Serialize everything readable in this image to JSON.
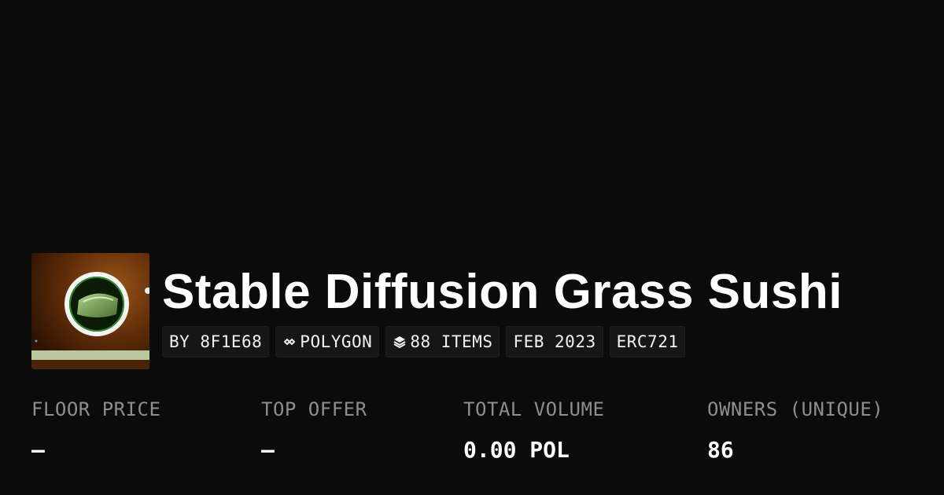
{
  "collection": {
    "title": "Stable Diffusion Grass Sushi",
    "thumbnail_alt": "sushi-plate-image",
    "tags": [
      {
        "icon": "",
        "label": "BY 8F1E68"
      },
      {
        "icon": "chain-link-icon",
        "label": "POLYGON"
      },
      {
        "icon": "layers-icon",
        "label": "88 ITEMS"
      },
      {
        "icon": "",
        "label": "FEB 2023"
      },
      {
        "icon": "",
        "label": "ERC721"
      }
    ]
  },
  "stats": [
    {
      "label": "FLOOR PRICE",
      "value": "–"
    },
    {
      "label": "TOP OFFER",
      "value": "–"
    },
    {
      "label": "TOTAL VOLUME",
      "value": "0.00 POL"
    },
    {
      "label": "OWNERS (UNIQUE)",
      "value": "86"
    }
  ],
  "colors": {
    "background": "#0b0b0b",
    "tag_background": "#161616",
    "label_gray": "#8e8e8e",
    "text": "#ffffff"
  }
}
